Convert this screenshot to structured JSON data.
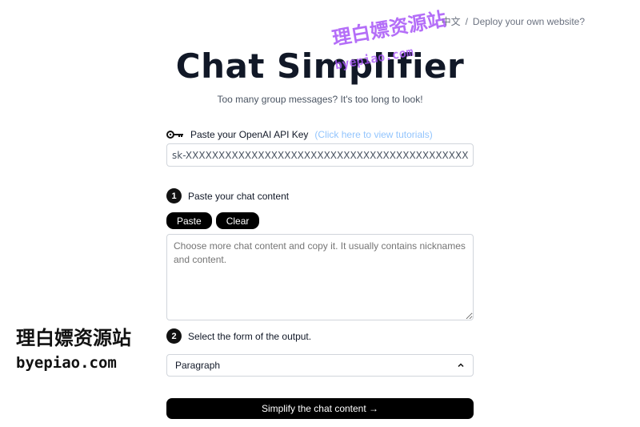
{
  "topbar": {
    "lang_label": "中文",
    "separator": "/",
    "deploy_label": "Deploy your own website?"
  },
  "header": {
    "title": "Chat Simplifier",
    "subtitle": "Too many group messages? It's too long to look!"
  },
  "api_key": {
    "label": "Paste your OpenAI API Key",
    "hint": "(Click here to view tutorials)",
    "value": "sk-XXXXXXXXXXXXXXXXXXXXXXXXXXXXXXXXXXXXXXXXXXXXXXXX"
  },
  "step1": {
    "number": "1",
    "label": "Paste your chat content",
    "paste_label": "Paste",
    "clear_label": "Clear",
    "placeholder": "Choose more chat content and copy it. It usually contains nicknames and content."
  },
  "step2": {
    "number": "2",
    "label": "Select the form of the output.",
    "selected": "Paragraph"
  },
  "submit": {
    "label": "Simplify the chat content →"
  },
  "watermark": {
    "top_text": "理白嫖资源站",
    "top_sub": "byepiao.com",
    "left_text": "理白嫖资源站",
    "left_sub": "byepiao.com"
  }
}
